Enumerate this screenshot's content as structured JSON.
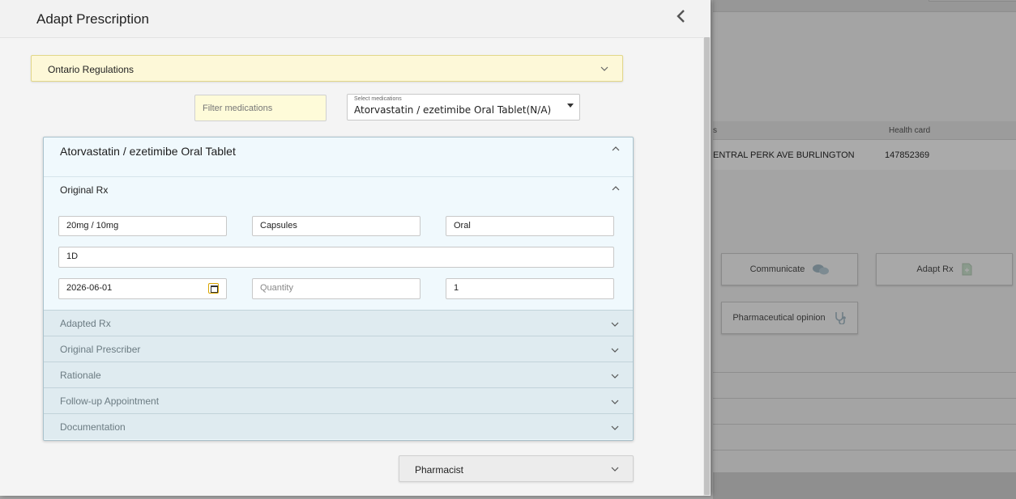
{
  "modal": {
    "title": "Adapt Prescription",
    "regulations": {
      "label": "Ontario Regulations"
    },
    "filter": {
      "placeholder": "Filter medications"
    },
    "select_medication": {
      "caption": "Select medications",
      "value": "Atorvastatin / ezetimibe Oral Tablet(N/A)"
    },
    "medication_panel": {
      "title": "Atorvastatin / ezetimibe Oral Tablet",
      "original_rx": {
        "title": "Original Rx",
        "strength": "20mg / 10mg",
        "form": "Capsules",
        "route": "Oral",
        "directions": "1D",
        "date": "2026-06-01",
        "quantity_placeholder": "Quantity",
        "refills": "1"
      },
      "sections": [
        "Adapted Rx",
        "Original Prescriber",
        "Rationale",
        "Follow-up Appointment",
        "Documentation"
      ]
    },
    "pharmacist": {
      "label": "Pharmacist"
    }
  },
  "background": {
    "table_headers": [
      "s",
      "Health card"
    ],
    "table_row": [
      "ENTRAL PERK AVE BURLINGTON",
      "147852369"
    ],
    "buttons": [
      "Communicate",
      "Adapt Rx",
      "Pharmaceutical opinion"
    ],
    "icons": [
      "chat-bubbles-icon",
      "document-icon",
      "stethoscope-icon"
    ]
  },
  "colors": {
    "regulations_bg": "#fdf8d8",
    "filter_bg": "#fefbd9",
    "panel_bg": "#f0f9fd",
    "accordion_bg": "#dfebf0",
    "backdrop": "#a4a4a4"
  }
}
